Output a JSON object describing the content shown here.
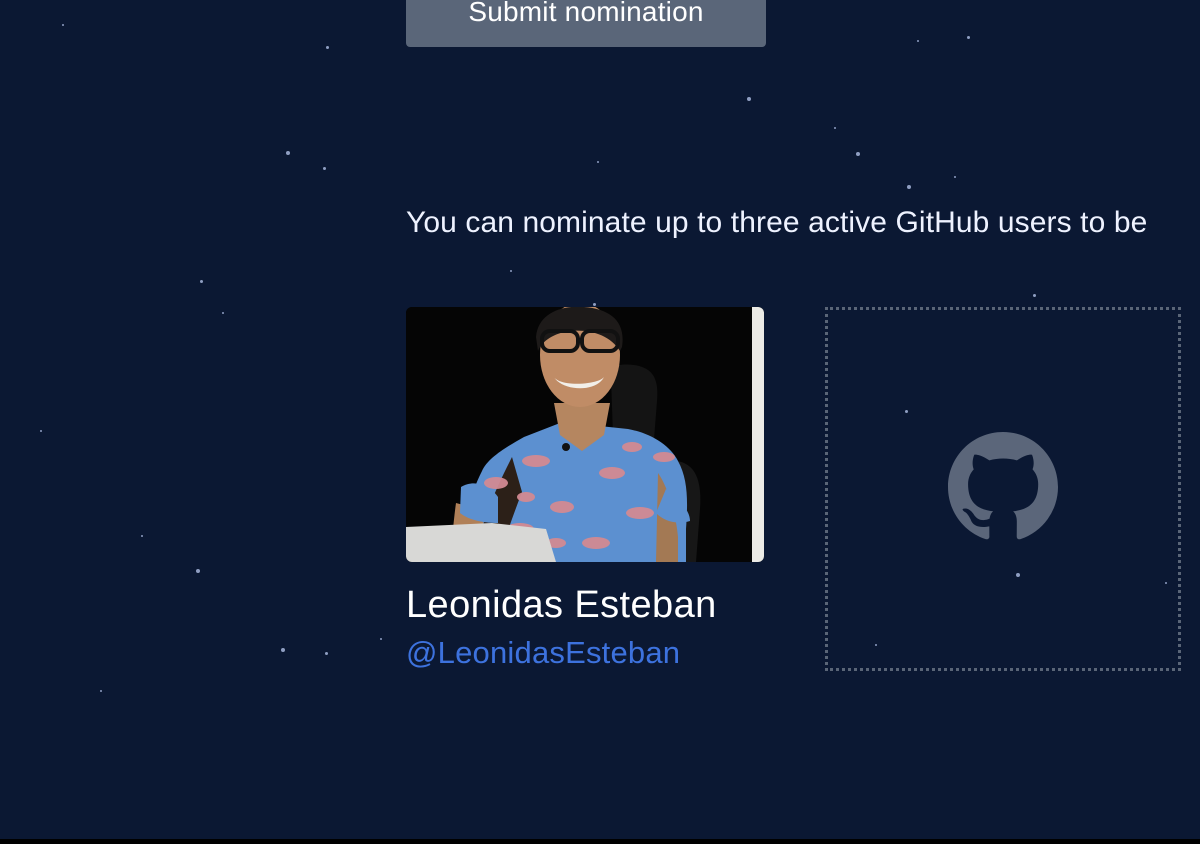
{
  "submit": {
    "label": "Submit nomination"
  },
  "intro": {
    "text": "You can nominate up to three active GitHub users to be"
  },
  "nominees": [
    {
      "name": "Leonidas Esteban",
      "handle": "@LeonidasEsteban"
    }
  ],
  "empty_slot": {
    "icon": "github-mark-icon"
  },
  "colors": {
    "background": "#0b1833",
    "button": "#5a6679",
    "handle": "#3d72de",
    "slot_border": "#5a6577"
  }
}
